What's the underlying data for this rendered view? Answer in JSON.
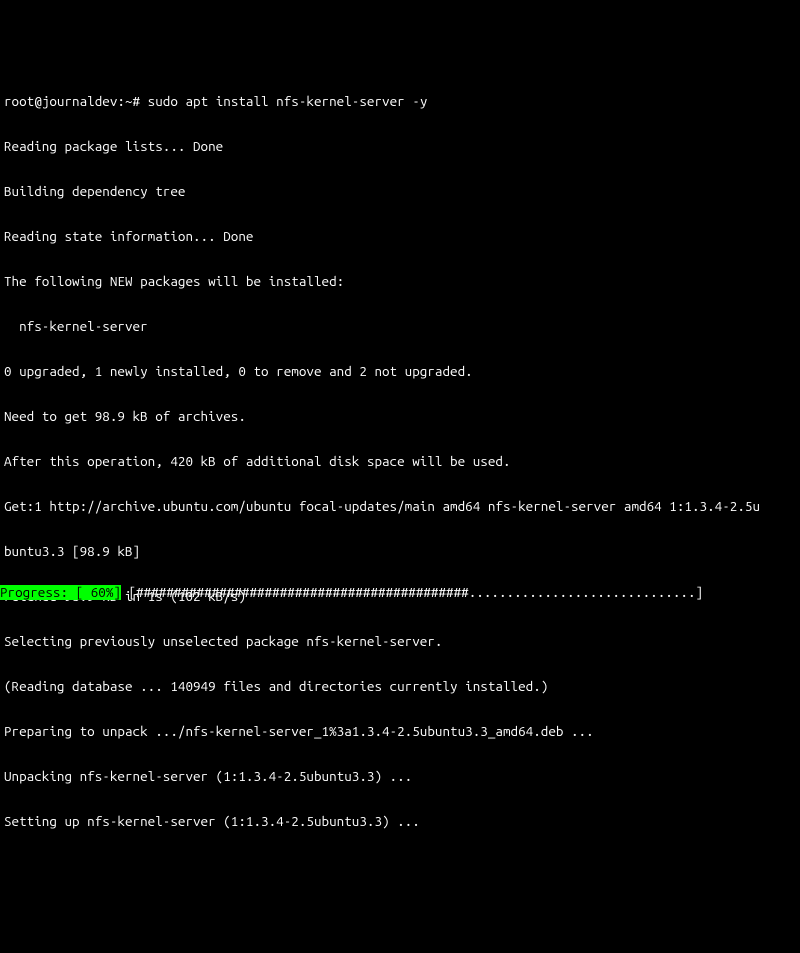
{
  "prompt": {
    "user_host": "root@journaldev",
    "path": "~",
    "symbol": "#",
    "command": "sudo apt install nfs-kernel-server -y"
  },
  "lines": [
    "Reading package lists... Done",
    "Building dependency tree",
    "Reading state information... Done",
    "The following NEW packages will be installed:",
    "  nfs-kernel-server",
    "0 upgraded, 1 newly installed, 0 to remove and 2 not upgraded.",
    "Need to get 98.9 kB of archives.",
    "After this operation, 420 kB of additional disk space will be used.",
    "Get:1 http://archive.ubuntu.com/ubuntu focal-updates/main amd64 nfs-kernel-server amd64 1:1.3.4-2.5u",
    "buntu3.3 [98.9 kB]",
    "Fetched 98.9 kB in 1s (102 kB/s)",
    "Selecting previously unselected package nfs-kernel-server.",
    "(Reading database ... 140949 files and directories currently installed.)",
    "Preparing to unpack .../nfs-kernel-server_1%3a1.3.4-2.5ubuntu3.3_amd64.deb ...",
    "Unpacking nfs-kernel-server (1:1.3.4-2.5ubuntu3.3) ...",
    "Setting up nfs-kernel-server (1:1.3.4-2.5ubuntu3.3) ..."
  ],
  "progress": {
    "label": "Progress: [ 60%]",
    "open": " [",
    "fill": "############################################",
    "remain": "..............................]",
    "close": " "
  }
}
